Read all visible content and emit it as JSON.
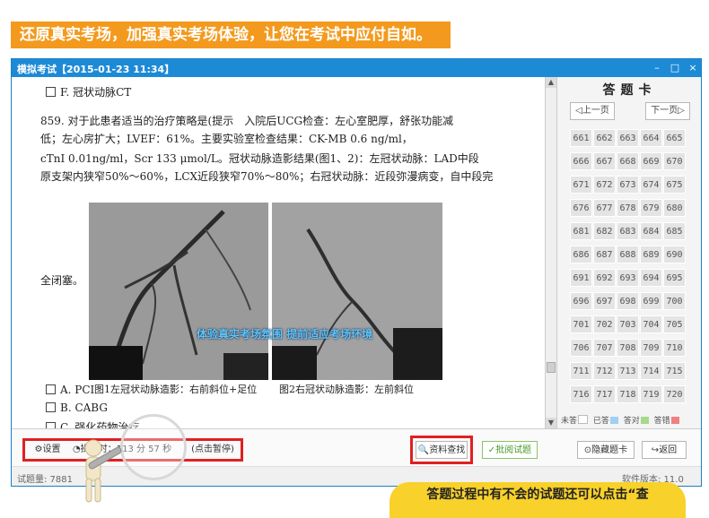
{
  "banner": {
    "text": "还原真实考场，加强真实考场体验，让您在考试中应付自如。"
  },
  "window": {
    "title": "模拟考试【2015-01-23 11:34】",
    "controls": {
      "minimize": "–",
      "maximize": "□",
      "close": "×"
    }
  },
  "question": {
    "option_f": "F. 冠状动脉CT",
    "stem_lines": [
      "859. 对于此患者适当的治疗策略是(提示　入院后UCG检查：左心室肥厚，舒张功能减",
      "低；左心房扩大；LVEF：61%。主要实验室检查结果：CK-MB 0.6 ng/ml，",
      "cTnI 0.01ng/ml，Scr 133 μmol/L。冠状动脉造影结果(图1、2)：左冠状动脉：LAD中段",
      "原支架内狭窄50%～60%，LCX近段狭窄70%～80%；右冠状动脉：近段弥漫病变，自中段完"
    ],
    "stem_tail": "全闭塞。",
    "figure1_caption": "图1左冠状动脉造影：右前斜位+足位",
    "figure2_caption": "图2右冠状动脉造影：左前斜位",
    "watermark": "体验真实考场氛围 提前适应考场环境",
    "options": [
      "A. PCI",
      "B. CABG",
      "C. 强化药物治疗"
    ]
  },
  "answer_sheet": {
    "heading": "答题卡",
    "prev_page": "◁上一页",
    "next_page": "下一页▷",
    "numbers": [
      [
        "661",
        "662",
        "663",
        "664",
        "665"
      ],
      [
        "666",
        "667",
        "668",
        "669",
        "670"
      ],
      [
        "671",
        "672",
        "673",
        "674",
        "675"
      ],
      [
        "676",
        "677",
        "678",
        "679",
        "680"
      ],
      [
        "681",
        "682",
        "683",
        "684",
        "685"
      ],
      [
        "686",
        "687",
        "688",
        "689",
        "690"
      ],
      [
        "691",
        "692",
        "693",
        "694",
        "695"
      ],
      [
        "696",
        "697",
        "698",
        "699",
        "700"
      ],
      [
        "701",
        "702",
        "703",
        "704",
        "705"
      ],
      [
        "706",
        "707",
        "708",
        "709",
        "710"
      ],
      [
        "711",
        "712",
        "713",
        "714",
        "715"
      ],
      [
        "716",
        "717",
        "718",
        "719",
        "720"
      ]
    ],
    "legend": [
      {
        "label": "未答",
        "color": "#ffffff"
      },
      {
        "label": "已答",
        "color": "#9fd0f2"
      },
      {
        "label": "答对",
        "color": "#a6d98a"
      },
      {
        "label": "答错",
        "color": "#f08080"
      }
    ]
  },
  "toolbar": {
    "settings_label": "设置",
    "timer_prefix": "操作时：",
    "timer_value": "113 分 57 秒",
    "pause_label": "(点击暂停)",
    "lookup_label": "资料查找",
    "grade_label": "批阅试题",
    "hide_sheet_label": "隐藏题卡",
    "back_label": "返回"
  },
  "status": {
    "question_count": "试题量: 7881",
    "version": "软件版本: 11.0"
  },
  "callout": {
    "text": "答题过程中有不会的试题还可以点击“查"
  },
  "colors": {
    "banner": "#f39a1e",
    "titlebar": "#1d8ad6",
    "highlight": "#e02020",
    "callout": "#f8d12a"
  }
}
